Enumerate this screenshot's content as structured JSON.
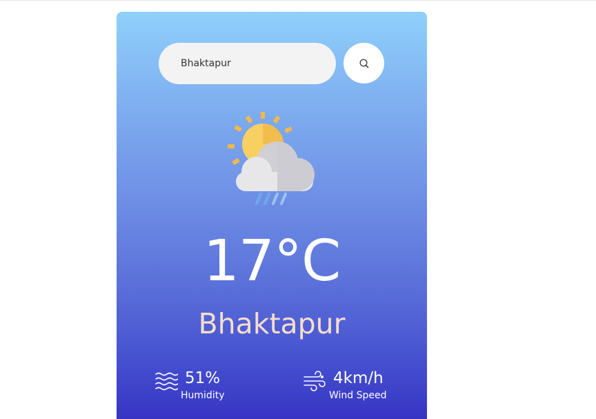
{
  "search": {
    "value": "Bhaktapur",
    "button_icon": "search-icon"
  },
  "weather": {
    "icon": "sun-cloud-rain-icon",
    "temperature": "17°C",
    "city": "Bhaktapur"
  },
  "details": {
    "humidity": {
      "icon": "humidity-waves-icon",
      "value": "51%",
      "label": "Humidity"
    },
    "wind": {
      "icon": "wind-icon",
      "value": "4km/h",
      "label": "Wind Speed"
    }
  },
  "colors": {
    "gradient_top": "#8fd0fb",
    "gradient_bottom": "#3734c4",
    "city_text": "#f5deca",
    "search_bg": "#f3f3f3"
  }
}
